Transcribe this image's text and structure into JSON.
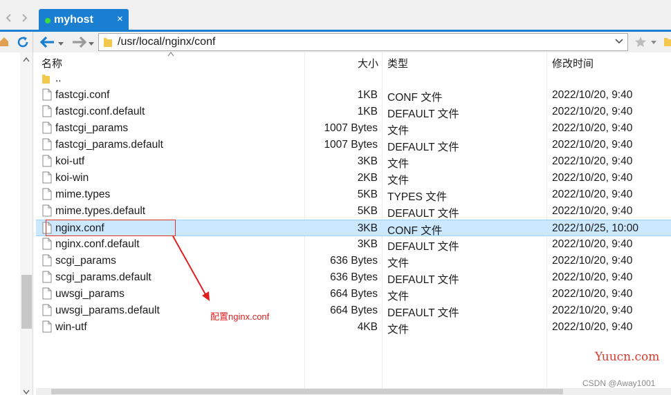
{
  "window": {
    "tab_title": "myhost",
    "tab_close": "×"
  },
  "address_bar": {
    "path": "/usr/local/nginx/conf"
  },
  "file_list": {
    "columns": {
      "name": "名称",
      "size": "大小",
      "type": "类型",
      "modified": "修改时间"
    },
    "parent_dir": "..",
    "rows": [
      {
        "name": "fastcgi.conf",
        "size": "1KB",
        "type": "CONF 文件",
        "modified": "2022/10/20, 9:40"
      },
      {
        "name": "fastcgi.conf.default",
        "size": "1KB",
        "type": "DEFAULT 文件",
        "modified": "2022/10/20, 9:40"
      },
      {
        "name": "fastcgi_params",
        "size": "1007 Bytes",
        "type": "文件",
        "modified": "2022/10/20, 9:40"
      },
      {
        "name": "fastcgi_params.default",
        "size": "1007 Bytes",
        "type": "DEFAULT 文件",
        "modified": "2022/10/20, 9:40"
      },
      {
        "name": "koi-utf",
        "size": "3KB",
        "type": "文件",
        "modified": "2022/10/20, 9:40"
      },
      {
        "name": "koi-win",
        "size": "2KB",
        "type": "文件",
        "modified": "2022/10/20, 9:40"
      },
      {
        "name": "mime.types",
        "size": "5KB",
        "type": "TYPES 文件",
        "modified": "2022/10/20, 9:40"
      },
      {
        "name": "mime.types.default",
        "size": "5KB",
        "type": "DEFAULT 文件",
        "modified": "2022/10/20, 9:40"
      },
      {
        "name": "nginx.conf",
        "size": "3KB",
        "type": "CONF 文件",
        "modified": "2022/10/25, 10:00",
        "selected": true
      },
      {
        "name": "nginx.conf.default",
        "size": "3KB",
        "type": "DEFAULT 文件",
        "modified": "2022/10/20, 9:40"
      },
      {
        "name": "scgi_params",
        "size": "636 Bytes",
        "type": "文件",
        "modified": "2022/10/20, 9:40"
      },
      {
        "name": "scgi_params.default",
        "size": "636 Bytes",
        "type": "DEFAULT 文件",
        "modified": "2022/10/20, 9:40"
      },
      {
        "name": "uwsgi_params",
        "size": "664 Bytes",
        "type": "文件",
        "modified": "2022/10/20, 9:40"
      },
      {
        "name": "uwsgi_params.default",
        "size": "664 Bytes",
        "type": "DEFAULT 文件",
        "modified": "2022/10/20, 9:40"
      },
      {
        "name": "win-utf",
        "size": "4KB",
        "type": "文件",
        "modified": "2022/10/20, 9:40"
      }
    ]
  },
  "annotation": {
    "text": "配置nginx.conf",
    "color": "#e02020"
  },
  "watermarks": {
    "site": "Yuucn.com",
    "author": "CSDN @Away1001"
  },
  "colors": {
    "accent": "#1a7fd0",
    "selection": "#cce8ff",
    "folder": "#f2c94c"
  }
}
